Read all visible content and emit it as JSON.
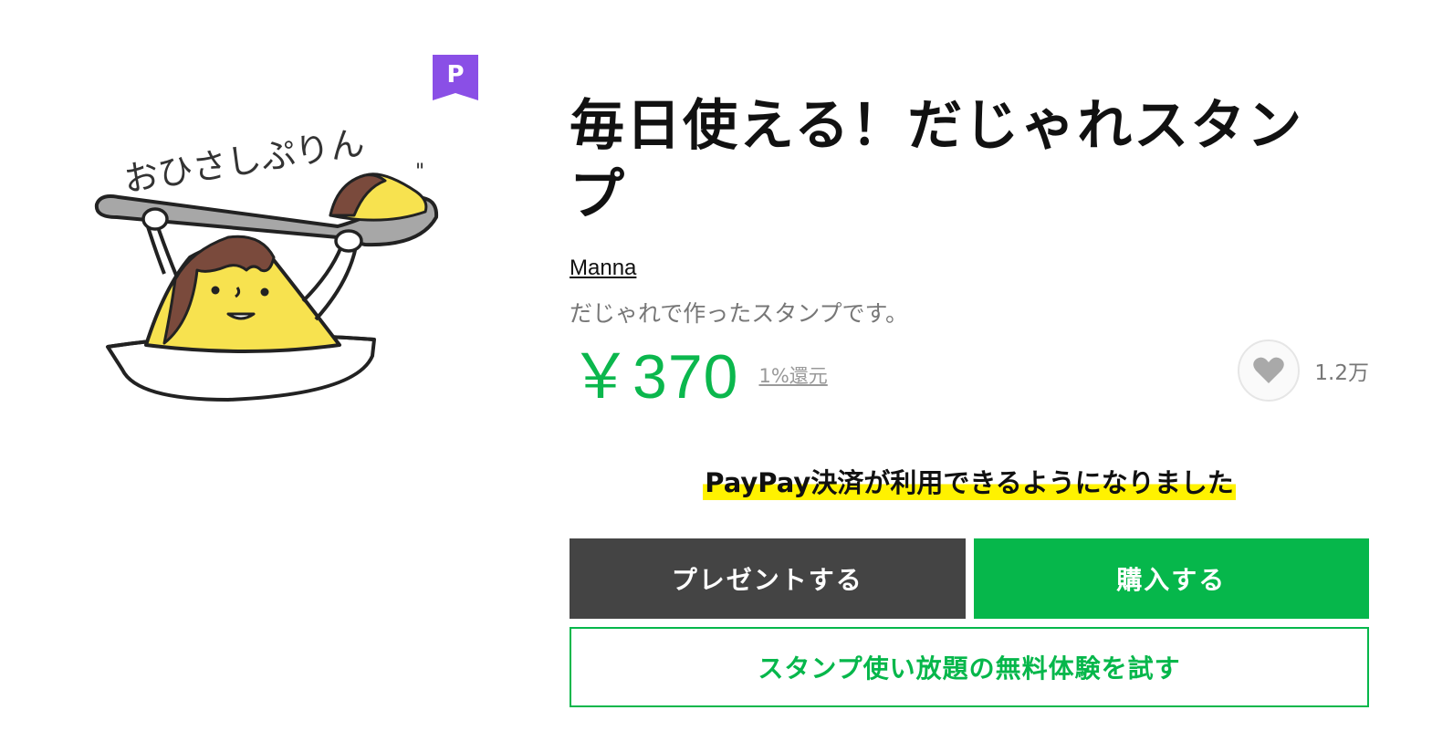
{
  "sticker": {
    "image_name": "sticker-main-image",
    "caption": "おひさしぷりん",
    "badge": "P",
    "badge_color": "#8a4fe6"
  },
  "product": {
    "title": "毎日使える！だじゃれスタンプ",
    "author": "Manna",
    "description": "だじゃれで作ったスタンプです。",
    "price": "￥370",
    "cashback": "1%還元",
    "like_icon": "heart-icon",
    "like_count": "1.2万"
  },
  "notice": {
    "text": "PayPay決済が利用できるようになりました"
  },
  "actions": {
    "present_label": "プレゼントする",
    "buy_label": "購入する",
    "trial_label": "スタンプ使い放題の無料体験を試す"
  },
  "colors": {
    "price_green": "#0bb74d",
    "buy_green": "#06b74b",
    "present_dark": "#444444",
    "highlight_yellow": "#fff200"
  }
}
